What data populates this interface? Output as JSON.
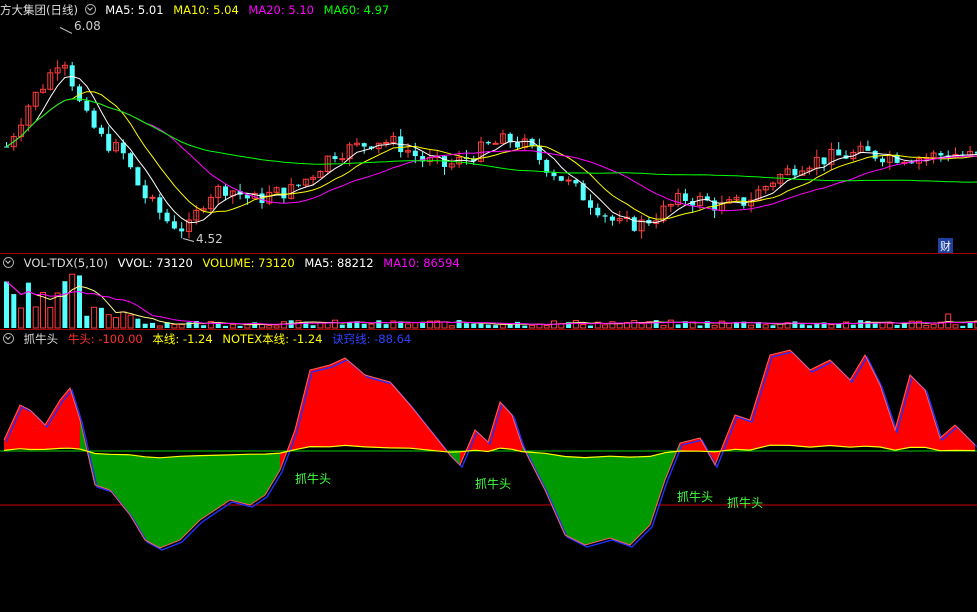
{
  "colors": {
    "up": "#ff3c3c",
    "down": "#54ffff",
    "ma5": "#ffffff",
    "ma10": "#ffff00",
    "ma20": "#ff00ff",
    "ma60": "#00ff00",
    "bull": "#ff0000",
    "bear": "#009900"
  },
  "price_panel": {
    "stock_name": "方大集团(日线)",
    "ma5": "MA5: 5.01",
    "ma10": "MA10: 5.04",
    "ma20": "MA20: 5.10",
    "ma60": "MA60: 4.97",
    "high_label": "6.08",
    "low_label": "4.52",
    "finance_badge": "财"
  },
  "volume_panel": {
    "indicator": "VOL-TDX(5,10)",
    "vvol": "VVOL: 73120",
    "volume": "VOLUME: 73120",
    "ma5": "MA5: 88212",
    "ma10": "MA10: 86594"
  },
  "signal_panel": {
    "indicator": "抓牛头",
    "niutou": "牛头: -100.00",
    "benxian": "本线: -1.24",
    "notex": "NOTEX本线: -1.24",
    "jueqi": "诀窍线: -88.64",
    "signals": [
      "抓牛头",
      "抓牛头",
      "抓牛头",
      "抓牛头"
    ]
  },
  "chart_data": {
    "type": "candlestick",
    "price_axis_range": [
      4.45,
      6.15
    ],
    "price_high": 6.08,
    "price_low": 4.52,
    "ohlc_samples": [
      {
        "o": 5.2,
        "h": 5.4,
        "l": 5.1,
        "c": 5.35
      },
      {
        "o": 5.35,
        "h": 5.7,
        "l": 5.3,
        "c": 5.6
      },
      {
        "o": 5.6,
        "h": 6.08,
        "l": 5.5,
        "c": 5.95
      },
      {
        "o": 5.95,
        "h": 6.0,
        "l": 5.4,
        "c": 5.5
      },
      {
        "o": 5.5,
        "h": 5.55,
        "l": 5.0,
        "c": 5.1
      },
      {
        "o": 5.1,
        "h": 5.15,
        "l": 4.6,
        "c": 4.7
      },
      {
        "o": 4.7,
        "h": 4.9,
        "l": 4.52,
        "c": 4.8
      },
      {
        "o": 4.8,
        "h": 5.0,
        "l": 4.75,
        "c": 4.95
      },
      {
        "o": 4.95,
        "h": 5.2,
        "l": 4.9,
        "c": 5.15
      },
      {
        "o": 5.15,
        "h": 5.25,
        "l": 5.0,
        "c": 5.05
      },
      {
        "o": 5.05,
        "h": 5.1,
        "l": 4.8,
        "c": 4.85
      },
      {
        "o": 4.85,
        "h": 4.9,
        "l": 4.62,
        "c": 4.68
      },
      {
        "o": 4.68,
        "h": 4.9,
        "l": 4.65,
        "c": 4.85
      },
      {
        "o": 4.85,
        "h": 5.0,
        "l": 4.8,
        "c": 4.95
      },
      {
        "o": 4.95,
        "h": 5.15,
        "l": 4.9,
        "c": 5.1
      }
    ]
  }
}
